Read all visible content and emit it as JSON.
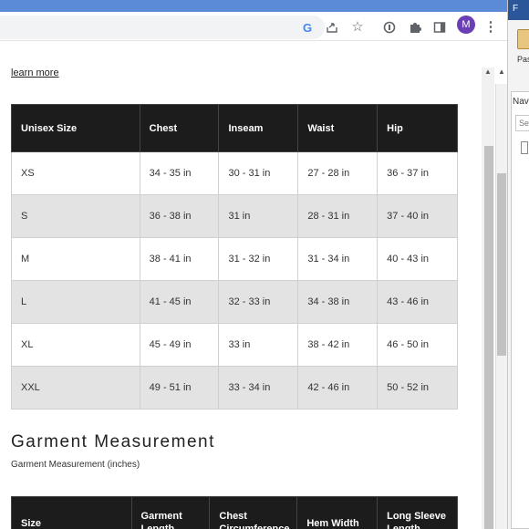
{
  "browser": {
    "toolbar_icons": [
      "google-g-icon",
      "share-icon",
      "star-icon",
      "extension-circle-icon",
      "puzzle-icon",
      "side-panel-icon",
      "kebab-menu-icon"
    ],
    "g_glyph": "G",
    "avatar_letter": "M"
  },
  "word": {
    "tab_label": "F",
    "paste_label": "Pas",
    "nav_label": "Nav",
    "search_placeholder": "Sea"
  },
  "page": {
    "learn_more": "learn more",
    "size_table": {
      "headers": [
        "Unisex Size",
        "Chest",
        "Inseam",
        "Waist",
        "Hip"
      ],
      "rows": [
        [
          "XS",
          "34 - 35 in",
          "30 - 31 in",
          "27 - 28 in",
          "36 - 37 in"
        ],
        [
          "S",
          "36 - 38 in",
          "31 in",
          "28 - 31 in",
          "37 - 40 in"
        ],
        [
          "M",
          "38 - 41 in",
          "31 - 32 in",
          "31 - 34 in",
          "40 - 43 in"
        ],
        [
          "L",
          "41 - 45 in",
          "32 - 33 in",
          "34 - 38 in",
          "43 - 46 in"
        ],
        [
          "XL",
          "45 - 49 in",
          "33 in",
          "38 - 42 in",
          "46 - 50 in"
        ],
        [
          "XXL",
          "49 - 51 in",
          "33 - 34 in",
          "42 - 46 in",
          "50 - 52 in"
        ]
      ]
    },
    "garment_title": "Garment Measurement",
    "garment_subtitle": "Garment Measurement (inches)",
    "garment_table": {
      "headers": [
        "Size",
        "Garment Length",
        "Chest Circumference",
        "Hem Width",
        "Long Sleeve Length"
      ]
    }
  }
}
